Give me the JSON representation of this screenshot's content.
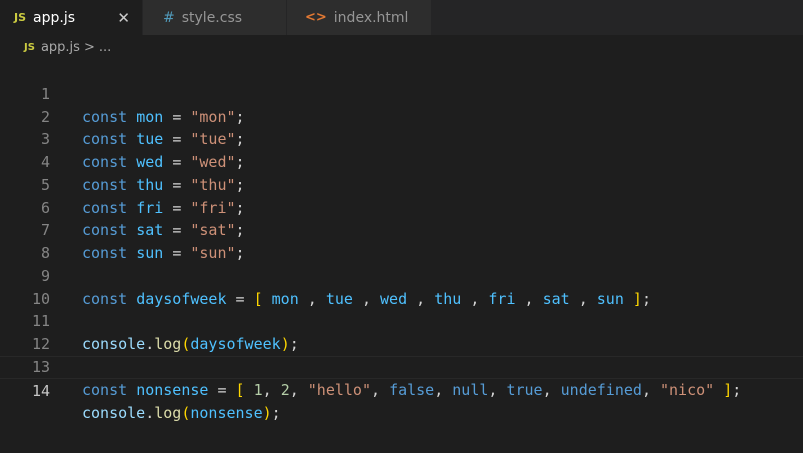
{
  "tabs": [
    {
      "icon": "JS",
      "label": "app.js",
      "close": "✕"
    },
    {
      "icon": "#",
      "label": "style.css"
    },
    {
      "icon": "<>",
      "label": "index.html"
    }
  ],
  "breadcrumb": {
    "icon": "JS",
    "file": "app.js",
    "sep": ">",
    "rest": "..."
  },
  "lines": [
    "1",
    "2",
    "3",
    "4",
    "5",
    "6",
    "7",
    "8",
    "9",
    "10",
    "11",
    "12",
    "13",
    "14"
  ],
  "code": {
    "l1": [
      "const",
      "mon",
      "=",
      "\"mon\"",
      ";"
    ],
    "l2": [
      "const",
      "tue",
      "=",
      "\"tue\"",
      ";"
    ],
    "l3": [
      "const",
      "wed",
      "=",
      "\"wed\"",
      ";"
    ],
    "l4": [
      "const",
      "thu",
      "=",
      "\"thu\"",
      ";"
    ],
    "l5": [
      "const",
      "fri",
      "=",
      "\"fri\"",
      ";"
    ],
    "l6": [
      "const",
      "sat",
      "=",
      "\"sat\"",
      ";"
    ],
    "l7": [
      "const",
      "sun",
      "=",
      "\"sun\"",
      ";"
    ],
    "l9": [
      "const",
      "daysofweek",
      "=",
      "[",
      "mon",
      ",",
      "tue",
      ",",
      "wed",
      ",",
      "thu",
      ",",
      "fri",
      ",",
      "sat",
      ",",
      "sun",
      "]",
      ";"
    ],
    "l11": [
      "console",
      ".",
      "log",
      "(",
      "daysofweek",
      ")",
      ";"
    ],
    "l13": [
      "const",
      "nonsense",
      "=",
      "[",
      "1",
      ",",
      "2",
      ",",
      "\"hello\"",
      ",",
      "false",
      ",",
      "null",
      ",",
      "true",
      ",",
      "undefined",
      ",",
      "\"nico\"",
      "]",
      ";"
    ],
    "l14": [
      "console",
      ".",
      "log",
      "(",
      "nonsense",
      ")",
      ";"
    ]
  }
}
